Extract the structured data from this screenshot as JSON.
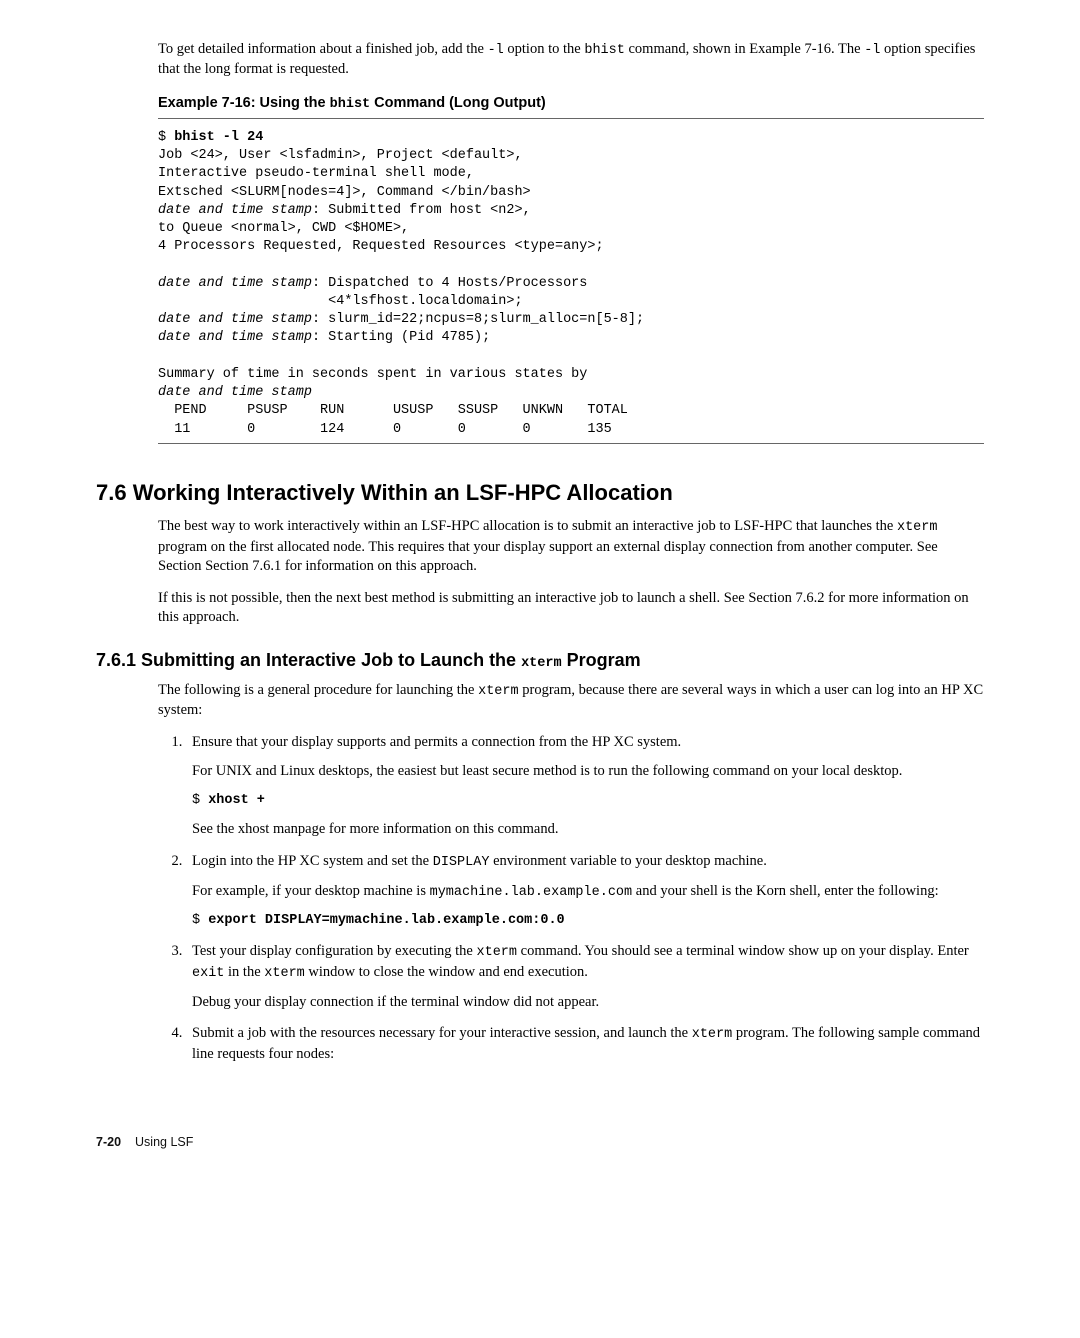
{
  "intro": {
    "p1a": "To get detailed information about a finished job, add the ",
    "p1b": "-l",
    "p1c": " option to the ",
    "p1d": "bhist",
    "p1e": " command, shown in Example 7-16. The ",
    "p1f": "-l",
    "p1g": " option specifies that the long format is requested."
  },
  "example_title_prefix": "Example 7-16: Using the ",
  "example_title_cmd": "bhist",
  "example_title_suffix": " Command (Long Output)",
  "code": {
    "l1a": "$ ",
    "l1b": "bhist -l 24",
    "l2": "Job <24>, User <lsfadmin>, Project <default>,",
    "l3": "Interactive pseudo-terminal shell mode,",
    "l4": "Extsched <SLURM[nodes=4]>, Command </bin/bash>",
    "l5a": "date and time stamp",
    "l5b": ": Submitted from host <n2>,",
    "l6": "to Queue <normal>, CWD <$HOME>,",
    "l7": "4 Processors Requested, Requested Resources <type=any>;",
    "l8": "",
    "l9a": "date and time stamp",
    "l9b": ": Dispatched to 4 Hosts/Processors",
    "l10": "                     <4*lsfhost.localdomain>;",
    "l11a": "date and time stamp",
    "l11b": ": slurm_id=22;ncpus=8;slurm_alloc=n[5-8];",
    "l12a": "date and time stamp",
    "l12b": ": Starting (Pid 4785);",
    "l13": "",
    "l14": "Summary of time in seconds spent in various states by",
    "l15a": "date and time stamp",
    "l16": "  PEND     PSUSP    RUN      USUSP   SSUSP   UNKWN   TOTAL",
    "l17": "  11       0        124      0       0       0       135"
  },
  "section": {
    "h2": "7.6  Working Interactively Within an LSF-HPC Allocation",
    "p1a": "The best way to work interactively within an LSF-HPC allocation is to submit an interactive job to LSF-HPC that launches the ",
    "p1b": "xterm",
    "p1c": " program on the first allocated node. This requires that your display support an external display connection from another computer. See Section Section 7.6.1 for information on this approach.",
    "p2": "If this is not possible, then the next best method is submitting an interactive job to launch a shell. See Section 7.6.2 for more information on this approach.",
    "h3a": "7.6.1  Submitting an Interactive Job to Launch the ",
    "h3b": "xterm",
    "h3c": " Program",
    "p3a": "The following is a general procedure for launching the ",
    "p3b": "xterm",
    "p3c": " program, because there are several ways in which a user can log into an HP XC system:"
  },
  "steps": {
    "s1p1": "Ensure that your display supports and permits a connection from the HP XC system.",
    "s1p2": "For UNIX and Linux desktops, the easiest but least secure method is to run the following command on your local desktop.",
    "s1cmd_a": "$ ",
    "s1cmd_b": "xhost +",
    "s1p3": "See the xhost manpage for more information on this command.",
    "s2p1a": "Login into the HP XC system and set the ",
    "s2p1b": "DISPLAY",
    "s2p1c": " environment variable to your desktop machine.",
    "s2p2a": "For example, if your desktop machine is ",
    "s2p2b": "mymachine.lab.example.com",
    "s2p2c": " and your shell is the Korn shell, enter the following:",
    "s2cmd_a": "$ ",
    "s2cmd_b": "export DISPLAY=mymachine.lab.example.com:0.0",
    "s3p1a": "Test your display configuration by executing the ",
    "s3p1b": "xterm",
    "s3p1c": " command. You should see a terminal window show up on your display. Enter ",
    "s3p1d": "exit",
    "s3p1e": " in the ",
    "s3p1f": "xterm",
    "s3p1g": " window to close the window and end execution.",
    "s3p2": "Debug your display connection if the terminal window did not appear.",
    "s4p1a": "Submit a job with the resources necessary for your interactive session, and launch the ",
    "s4p1b": "xterm",
    "s4p1c": " program. The following sample command line requests four nodes:"
  },
  "footer": {
    "page": "7-20",
    "label": "Using LSF"
  },
  "chart_data": {
    "type": "table",
    "title": "Summary of time in seconds spent in various states",
    "columns": [
      "PEND",
      "PSUSP",
      "RUN",
      "USUSP",
      "SSUSP",
      "UNKWN",
      "TOTAL"
    ],
    "rows": [
      [
        11,
        0,
        124,
        0,
        0,
        0,
        135
      ]
    ]
  }
}
